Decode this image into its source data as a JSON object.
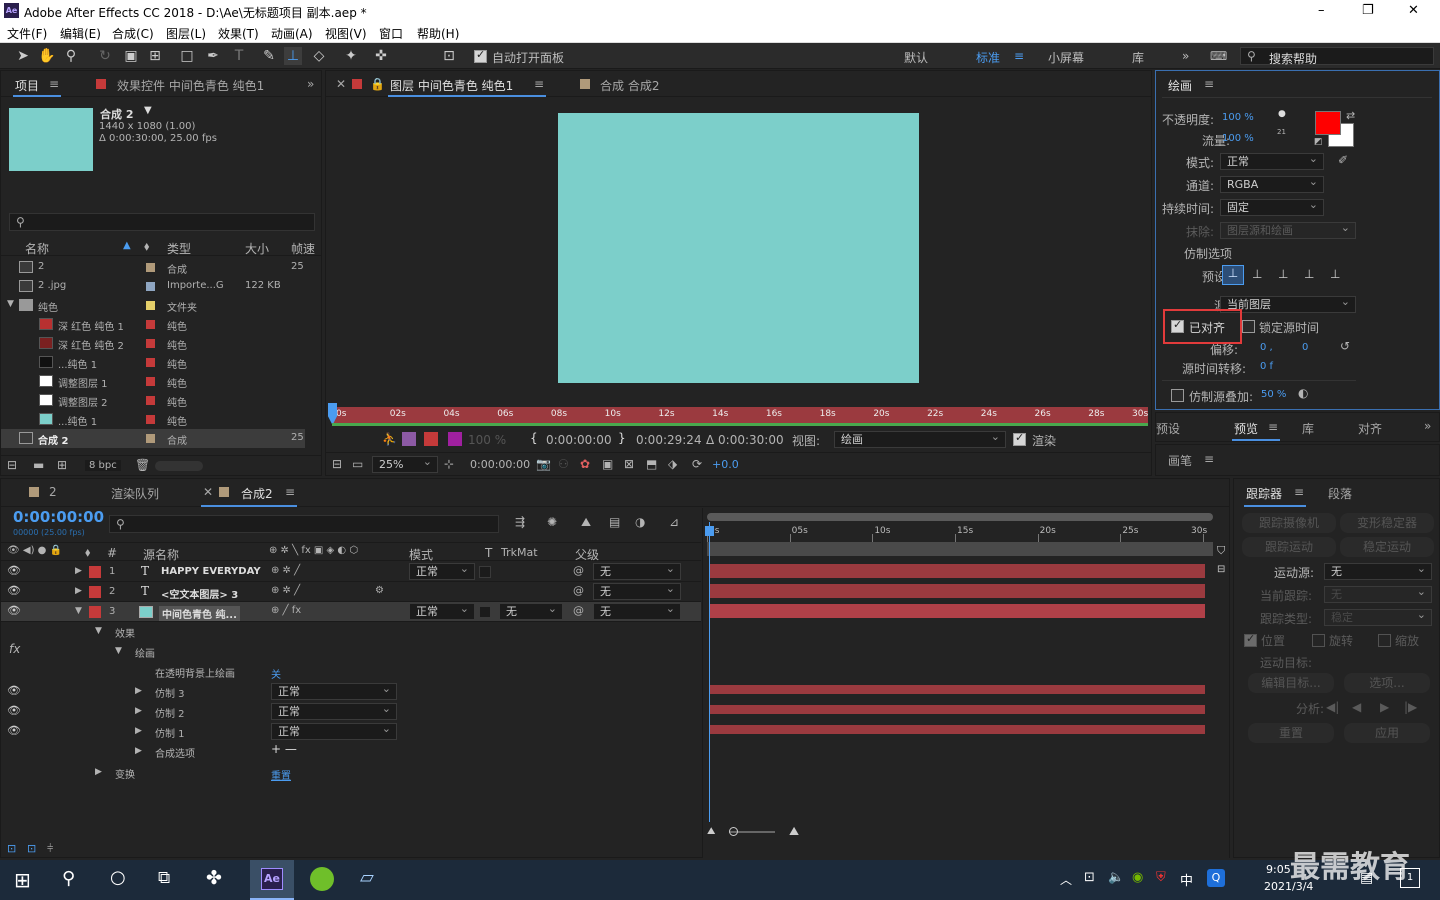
{
  "window": {
    "app_title": "Adobe After Effects CC 2018 - D:\\Ae\\无标题项目 副本.aep *",
    "logo": "Ae",
    "min": "–",
    "max": "❐",
    "close": "✕"
  },
  "menu": [
    "文件(F)",
    "编辑(E)",
    "合成(C)",
    "图层(L)",
    "效果(T)",
    "动画(A)",
    "视图(V)",
    "窗口",
    "帮助(H)"
  ],
  "toolbar": {
    "auto_open": "自动打开面板",
    "workspaces": [
      "默认",
      "标准",
      "小屏幕",
      "库"
    ],
    "search_placeholder": "搜索帮助"
  },
  "project": {
    "tabs": [
      "项目",
      "效果控件 中间色青色 纯色1"
    ],
    "comp_name": "合成 2",
    "comp_info1": "1440 x 1080 (1.00)",
    "comp_info2": "Δ 0:00:30:00, 25.00 fps",
    "columns": [
      "名称",
      "类型",
      "大小",
      "帧速"
    ],
    "items": [
      {
        "name": "2",
        "type": "合成",
        "size": "",
        "fps": "25",
        "color": "#b09a7a"
      },
      {
        "name": "2 .jpg",
        "type": "Importe...G",
        "size": "122 KB",
        "fps": "",
        "color": "#8fa6c2"
      },
      {
        "name": "纯色",
        "type": "文件夹",
        "size": "",
        "fps": "",
        "color": "#e5cf6a"
      },
      {
        "name": "深 红色 纯色 1",
        "type": "纯色",
        "size": "",
        "fps": "",
        "color": "#c53a3a"
      },
      {
        "name": "深 红色 纯色 2",
        "type": "纯色",
        "size": "",
        "fps": "",
        "color": "#c53a3a"
      },
      {
        "name": "...纯色 1",
        "type": "纯色",
        "size": "",
        "fps": "",
        "color": "#c53a3a"
      },
      {
        "name": "调整图层 1",
        "type": "纯色",
        "size": "",
        "fps": "",
        "color": "#c53a3a"
      },
      {
        "name": "调整图层 2",
        "type": "纯色",
        "size": "",
        "fps": "",
        "color": "#c53a3a"
      },
      {
        "name": "...纯色 1",
        "type": "纯色",
        "size": "",
        "fps": "",
        "color": "#c53a3a"
      },
      {
        "name": "合成 2",
        "type": "合成",
        "size": "",
        "fps": "25",
        "color": "#b09a7a"
      }
    ],
    "bpc": "8 bpc"
  },
  "viewer": {
    "tabs": [
      "图层 中间色青色 纯色1",
      "合成 合成2"
    ],
    "ruler": [
      "0s",
      "02s",
      "04s",
      "06s",
      "08s",
      "10s",
      "12s",
      "14s",
      "16s",
      "18s",
      "20s",
      "22s",
      "24s",
      "26s",
      "28s",
      "30s"
    ],
    "opacity": "100 %",
    "tc_in": "0:00:00:00",
    "tc_out": "0:00:29:24",
    "tc_dur": "Δ 0:00:30:00",
    "view_label": "视图:",
    "view_value": "绘画",
    "render_label": "渲染",
    "zoom": "25%",
    "tc_now": "0:00:00:00",
    "exposure": "+0.0",
    "solid_color": "#7ccfca"
  },
  "paint": {
    "title": "绘画",
    "opacity_label": "不透明度:",
    "opacity": "100 %",
    "flow_label": "流量:",
    "flow": "100 %",
    "brush_size": "21",
    "mode_label": "模式:",
    "mode": "正常",
    "channel_label": "通道:",
    "channel": "RGBA",
    "duration_label": "持续时间:",
    "duration": "固定",
    "erase_label": "抹除:",
    "erase": "图层源和绘画",
    "clone_title": "仿制选项",
    "preset_label": "预设:",
    "source_label": "源:",
    "source": "当前图层",
    "aligned": "已对齐",
    "lock_time": "锁定源时间",
    "offset_label": "偏移:",
    "offset_x": "0 ,",
    "offset_y": "0",
    "time_shift_label": "源时间转移:",
    "time_shift": "0 f",
    "overlay_label": "仿制源叠加:",
    "overlay": "50 %",
    "fg_color": "#ff0000",
    "bg_color": "#ffffff"
  },
  "right_tabs": [
    "预设",
    "预览",
    "库",
    "对齐"
  ],
  "brush_tab": "画笔",
  "timeline": {
    "tabs": [
      "2",
      "渲染队列",
      "合成2"
    ],
    "timecode": "0:00:00:00",
    "fps_info": "00000 (25.00 fps)",
    "col_source": "源名称",
    "col_mode": "模式",
    "col_t": "T",
    "col_trk": "TrkMat",
    "col_parent": "父级",
    "ruler": [
      "0s",
      "05s",
      "10s",
      "15s",
      "20s",
      "25s",
      "30s"
    ],
    "layers": [
      {
        "num": "1",
        "type": "T",
        "name": "HAPPY EVERYDAY",
        "mode": "正常",
        "trk": "",
        "parent": "无",
        "color": "#c53a3a"
      },
      {
        "num": "2",
        "type": "T",
        "name": "<空文本图层> 3",
        "mode": "",
        "trk": "",
        "parent": "无",
        "color": "#c53a3a"
      },
      {
        "num": "3",
        "type": "",
        "name": "中间色青色 纯...",
        "mode": "正常",
        "trk": "无",
        "parent": "无",
        "color": "#c53a3a"
      }
    ],
    "props": {
      "effects": "效果",
      "paint": "绘画",
      "paint_transparent": "在透明背景上绘画",
      "paint_transparent_val": "关",
      "clones": [
        {
          "name": "仿制 3",
          "mode": "正常"
        },
        {
          "name": "仿制 2",
          "mode": "正常"
        },
        {
          "name": "仿制 1",
          "mode": "正常"
        }
      ],
      "composite": "合成选项",
      "composite_val": "+ —",
      "transform": "变换",
      "reset": "重置"
    }
  },
  "tracker": {
    "tabs": [
      "跟踪器",
      "段落"
    ],
    "track_camera": "跟踪摄像机",
    "warp": "变形稳定器",
    "track_motion": "跟踪运动",
    "stabilize": "稳定运动",
    "motion_source_label": "运动源:",
    "motion_source": "无",
    "current_track_label": "当前跟踪:",
    "current_track": "无",
    "track_type_label": "跟踪类型:",
    "track_type": "稳定",
    "position": "位置",
    "rotation": "旋转",
    "scale": "缩放",
    "motion_target": "运动目标:",
    "edit_target": "编辑目标...",
    "options": "选项...",
    "analyze": "分析:",
    "reset": "重置",
    "apply": "应用"
  },
  "taskbar": {
    "time": "9:05",
    "date": "2021/3/4",
    "ime": "中",
    "watermark": "最需教育",
    "badge": "1"
  }
}
